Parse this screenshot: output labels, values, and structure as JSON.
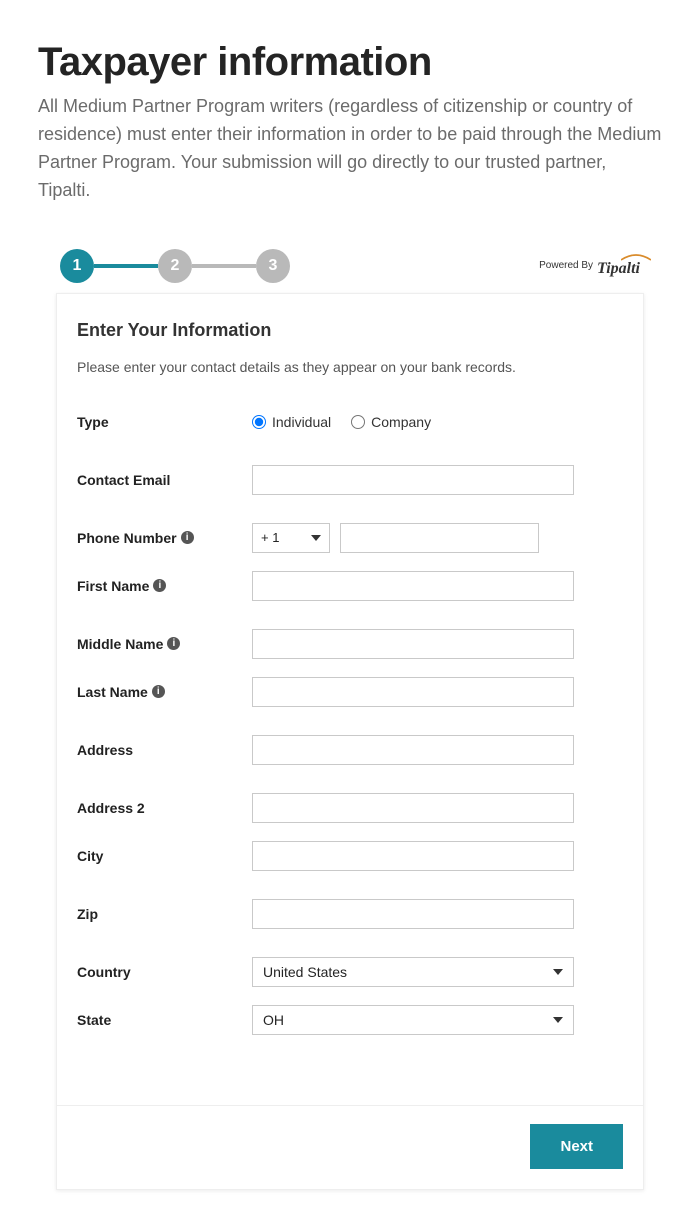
{
  "header": {
    "title": "Taxpayer information",
    "subtitle": "All Medium Partner Program writers (regardless of citizenship or country of residence) must enter their information in order to be paid through the Medium Partner Program. Your submission will go directly to our trusted partner, Tipalti."
  },
  "stepper": {
    "steps": [
      "1",
      "2",
      "3"
    ],
    "powered_label": "Powered By",
    "brand": "Tipalti"
  },
  "form": {
    "title": "Enter Your Information",
    "help": "Please enter your contact details as they appear on your bank records.",
    "labels": {
      "type": "Type",
      "contact_email": "Contact Email",
      "phone": "Phone Number",
      "first_name": "First Name",
      "middle_name": "Middle Name",
      "last_name": "Last Name",
      "address": "Address",
      "address2": "Address 2",
      "city": "City",
      "zip": "Zip",
      "country": "Country",
      "state": "State"
    },
    "type_options": {
      "individual": "Individual",
      "company": "Company"
    },
    "type_selected": "individual",
    "values": {
      "contact_email": "",
      "phone_cc": "+ 1",
      "phone": "",
      "first_name": "",
      "middle_name": "",
      "last_name": "",
      "address": "",
      "address2": "",
      "city": "",
      "zip": "",
      "country": "United States",
      "state": "OH"
    }
  },
  "footer": {
    "next": "Next"
  }
}
